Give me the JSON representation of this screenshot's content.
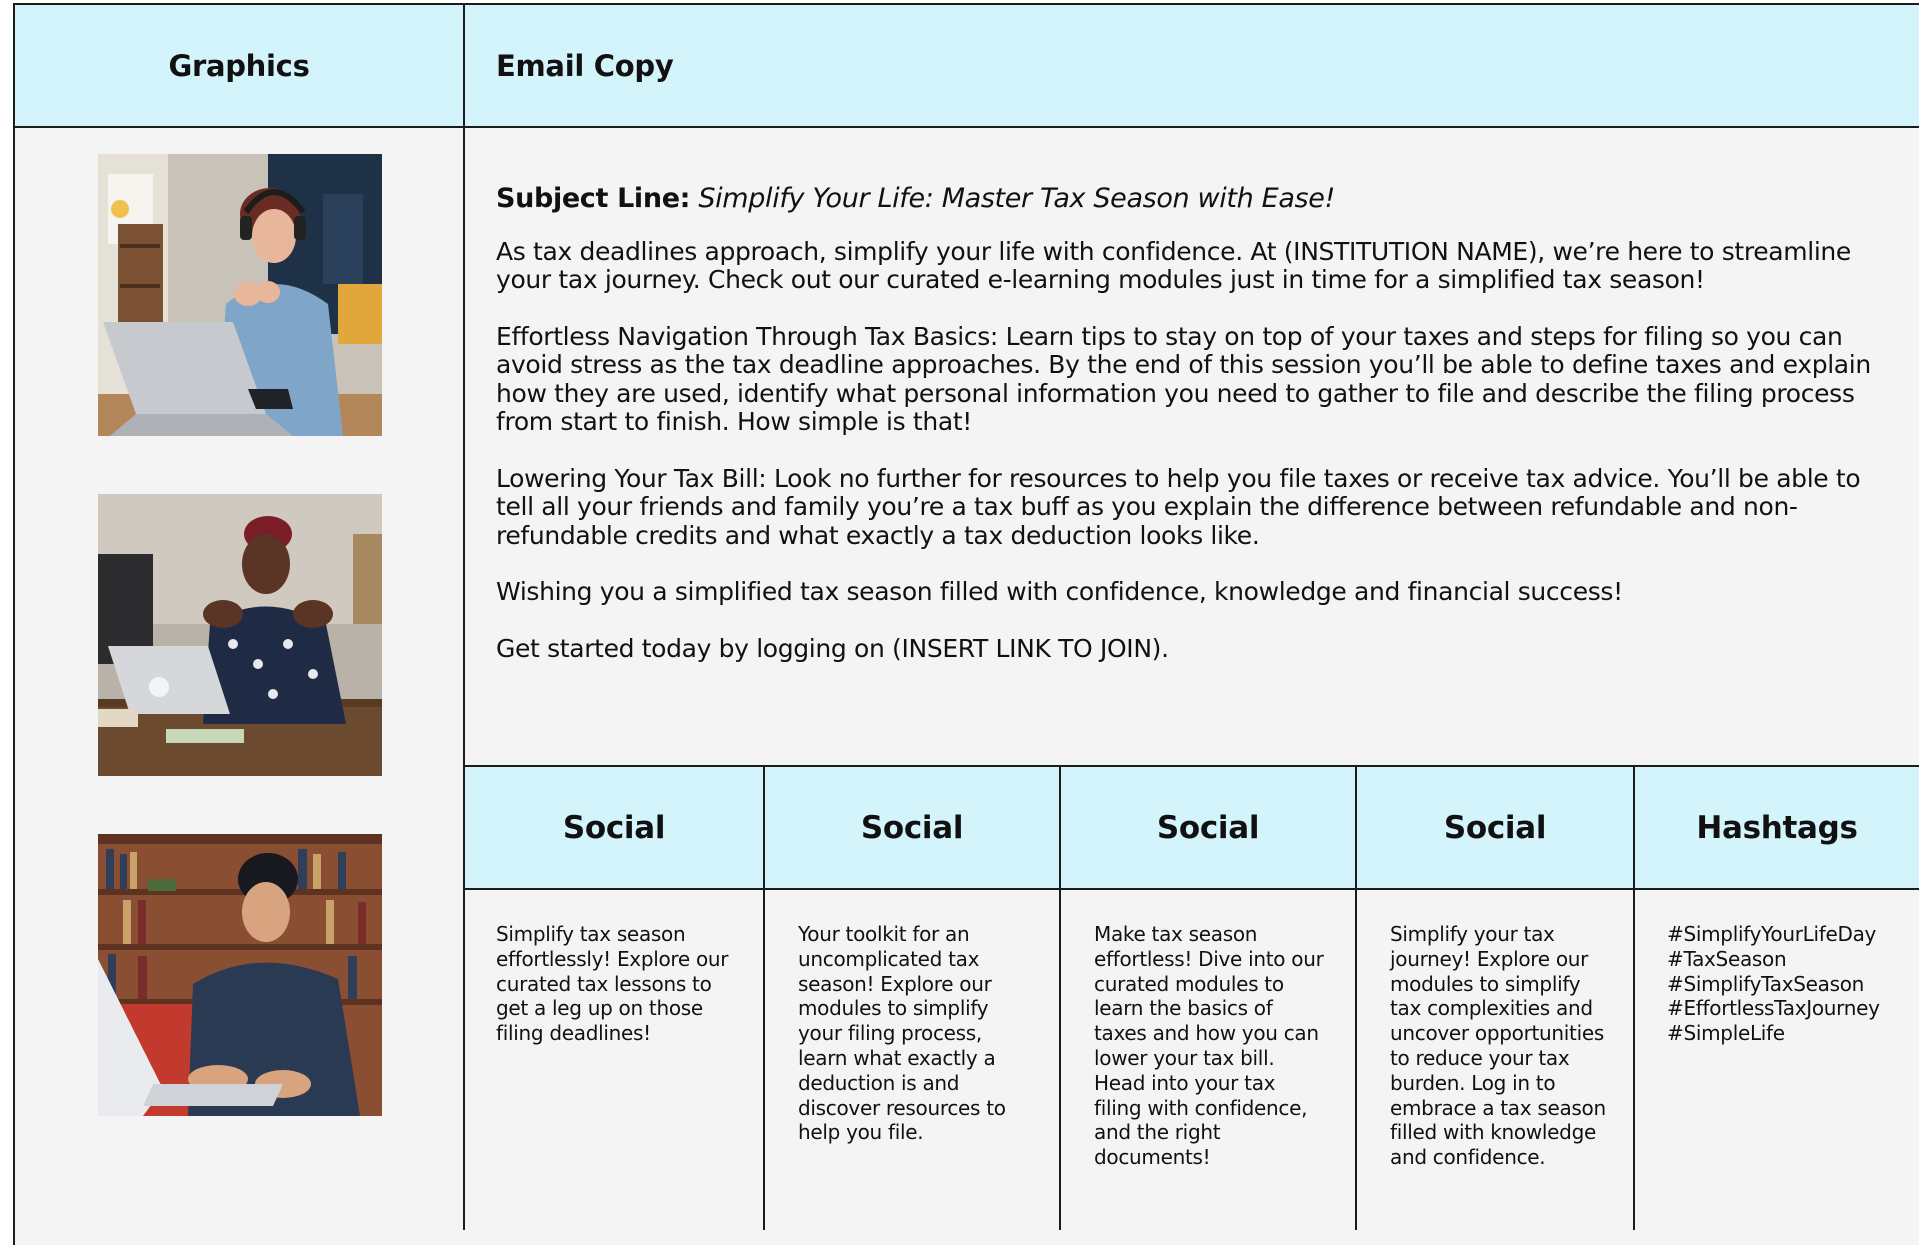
{
  "headers": {
    "graphics": "Graphics",
    "email_copy": "Email Copy"
  },
  "email": {
    "subject_label": "Subject Line:",
    "subject_text": "Simplify Your Life: Master Tax Season with Ease!",
    "paragraphs": [
      "As tax deadlines approach, simplify your life with confidence. At (INSTITUTION NAME), we’re here to streamline your tax journey.  Check out our curated e-learning modules just in time for a simplified tax season!",
      "Effortless Navigation Through Tax Basics: Learn tips to stay on top of your taxes and steps for filing so you can avoid stress as the tax deadline approaches.  By the end of this session you’ll be able to define taxes and explain how they are used, identify what personal information you need to gather to file and describe the filing process from start to finish.  How simple is that!",
      "Lowering Your Tax Bill: Look no further for resources to help you file taxes or receive tax advice.  You’ll be able to tell all your friends and family you’re a tax buff as you explain the difference between refundable and non-refundable credits and what exactly a tax deduction looks like.",
      "Wishing you a simplified tax season filled with confidence, knowledge and financial success!",
      "Get started today by logging on (INSERT LINK TO JOIN)."
    ]
  },
  "social": {
    "headers": [
      "Social",
      "Social",
      "Social",
      "Social",
      "Hashtags"
    ],
    "posts": [
      "Simplify tax season effortlessly! Explore our curated tax lessons to get a leg up on those filing deadlines!",
      "Your toolkit for an uncomplicated tax season! Explore our modules to simplify your filing process, learn what exactly a deduction is and discover resources to help you file.",
      "Make tax season effortless! Dive into our curated modules to learn the basics of taxes and how you can lower your tax bill.  Head into your tax filing with confidence, and the right documents!",
      "Simplify your tax journey! Explore our modules to simplify tax complexities and uncover opportunities to reduce your tax burden. Log in to embrace a tax season filled with knowledge and confidence."
    ],
    "hashtags": [
      "#SimplifyYourLifeDay",
      "#TaxSeason",
      "#SimplifyTaxSeason",
      "#EffortlessTaxJourney",
      "#SimpleLife"
    ]
  },
  "colors": {
    "header_bg": "#d4f4fc",
    "body_bg": "#f4f4f4",
    "border": "#1c1c1c"
  },
  "graphics": [
    "photo-woman-headphones-laptop",
    "photo-woman-laptop-table",
    "photo-man-laptop-bookshelf"
  ]
}
